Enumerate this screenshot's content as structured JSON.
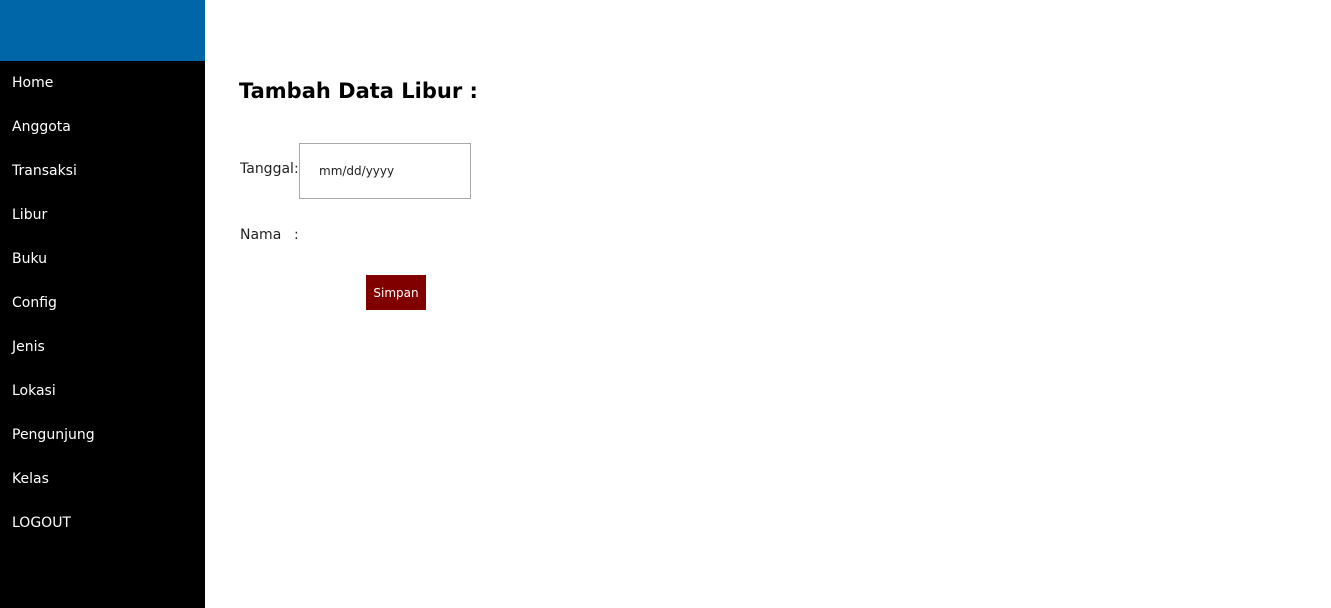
{
  "sidebar": {
    "items": [
      {
        "label": "Home"
      },
      {
        "label": "Anggota"
      },
      {
        "label": "Transaksi"
      },
      {
        "label": "Libur"
      },
      {
        "label": "Buku"
      },
      {
        "label": "Config"
      },
      {
        "label": "Jenis"
      },
      {
        "label": "Lokasi"
      },
      {
        "label": "Pengunjung"
      },
      {
        "label": "Kelas"
      },
      {
        "label": "LOGOUT"
      }
    ]
  },
  "form": {
    "title": "Tambah Data Libur :",
    "tanggal_label": "Tanggal",
    "tanggal_colon": ":",
    "tanggal_placeholder": "mm/dd/yyyy",
    "nama_label": "Nama",
    "nama_colon": ":",
    "submit_label": "Simpan"
  },
  "colors": {
    "sidebar_header": "#0066a8",
    "sidebar_bg": "#000000",
    "submit_button": "#800000"
  }
}
